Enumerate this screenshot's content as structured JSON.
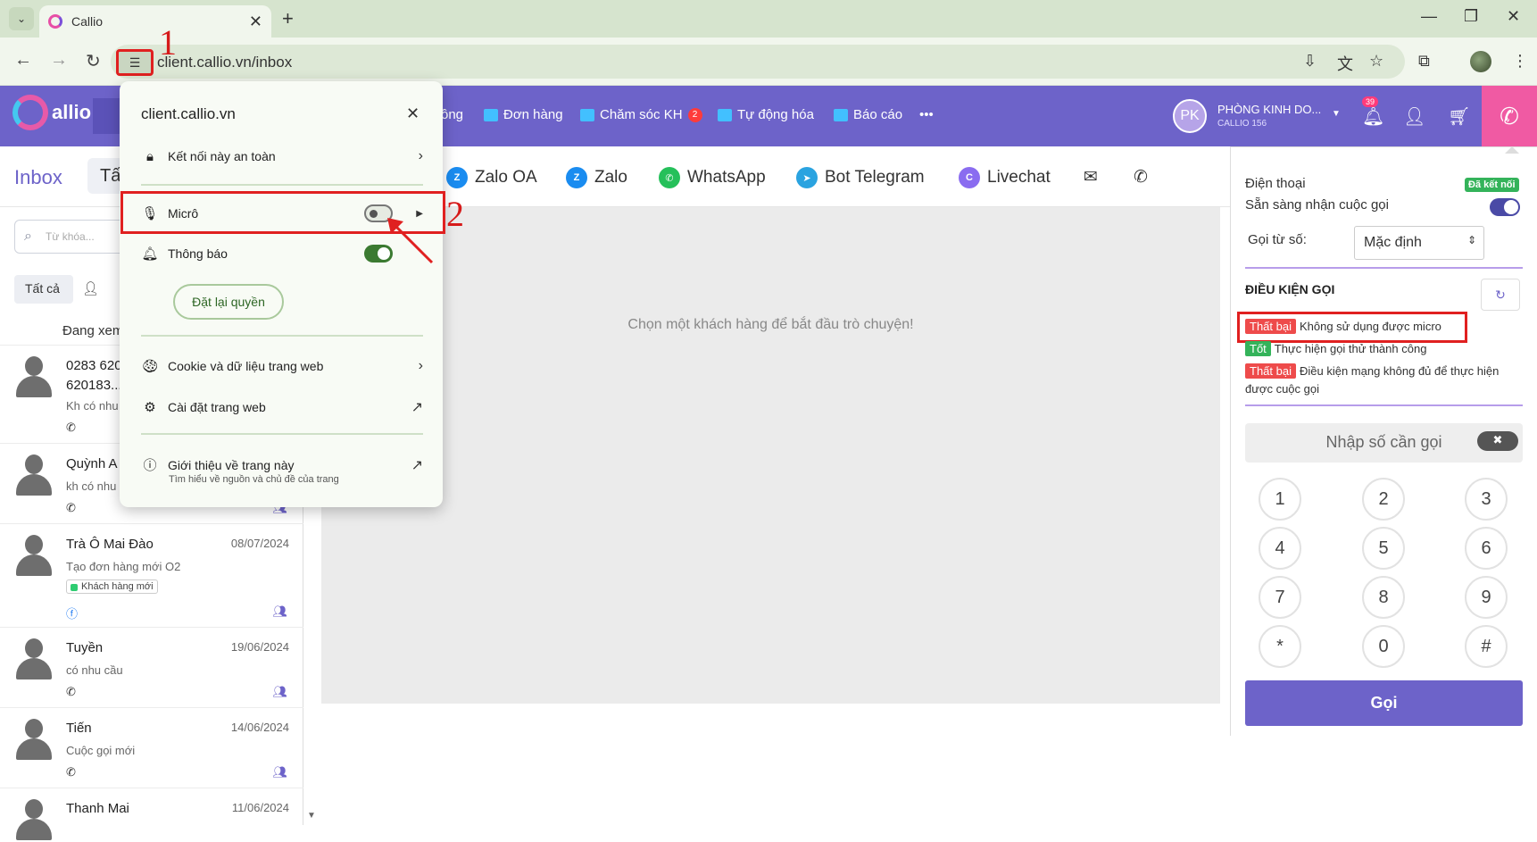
{
  "browser": {
    "tab_title": "Callio",
    "url": "client.callio.vn/inbox",
    "annotation_1": "1",
    "annotation_2": "2"
  },
  "app": {
    "logo_text": "allio",
    "nav": [
      {
        "label": "ồng"
      },
      {
        "label": "Đơn hàng"
      },
      {
        "label": "Chăm sóc KH",
        "badge": "2"
      },
      {
        "label": "Tự động hóa"
      },
      {
        "label": "Báo cáo"
      },
      {
        "label": "•••"
      }
    ],
    "user": {
      "initials": "PK",
      "name": "PHÒNG KINH DO...",
      "sub": "CALLIO 156"
    },
    "notif_count": "39"
  },
  "inbox": {
    "title": "Inbox",
    "tab_all_partial": "Tấ",
    "channels": [
      "Zalo OA",
      "Zalo",
      "WhatsApp",
      "Bot Telegram",
      "Livechat"
    ],
    "search_placeholder": "Từ khóa...",
    "filter_all": "Tất cả",
    "viewing_label": "Đang xem",
    "conversations": [
      {
        "name": "0283 620",
        "name2": "620183...",
        "snippet": "Kh có nhu",
        "date": ""
      },
      {
        "name": "Quỳnh A",
        "snippet": "kh có nhu",
        "date": ""
      },
      {
        "name": "Trà Ô Mai Đào",
        "snippet": "Tạo đơn hàng mới O2",
        "tag": "Khách hàng mới",
        "date": "08/07/2024"
      },
      {
        "name": "Tuyền",
        "snippet": "có nhu cầu",
        "date": "19/06/2024"
      },
      {
        "name": "Tiến",
        "snippet": "Cuộc gọi mới",
        "date": "14/06/2024"
      },
      {
        "name": "Thanh Mai",
        "snippet": "",
        "date": "11/06/2024"
      }
    ],
    "chat_empty": "Chọn một khách hàng để bắt đầu trò chuyện!"
  },
  "site_popup": {
    "host": "client.callio.vn",
    "secure": "Kết nối này an toàn",
    "micro": "Micrô",
    "notifications": "Thông báo",
    "reset": "Đặt lại quyền",
    "cookies": "Cookie và dữ liệu trang web",
    "site_settings": "Cài đặt trang web",
    "about": "Giới thiệu về trang này",
    "about_sub": "Tìm hiểu về nguồn và chủ đề của trang",
    "micro_enabled": false,
    "notifications_enabled": true
  },
  "phone": {
    "title": "Điện thoại",
    "status_badge": "Đã kết nối",
    "ready_label": "Sẵn sàng nhận cuộc gọi",
    "from_label": "Gọi từ số:",
    "from_value": "Mặc định",
    "cond_title": "ĐIỀU KIỆN GỌI",
    "conditions": [
      {
        "status": "Thất bại",
        "text": "Không sử dụng được micro"
      },
      {
        "status": "Tốt",
        "text": "Thực hiện gọi thử thành công"
      },
      {
        "status": "Thất bại",
        "text": "Điều kiện mạng không đủ để thực hiện được cuộc gọi"
      }
    ],
    "number_placeholder": "Nhập số cần gọi",
    "keys": [
      "1",
      "2",
      "3",
      "4",
      "5",
      "6",
      "7",
      "8",
      "9",
      "*",
      "0",
      "#"
    ],
    "call_label": "Gọi"
  }
}
